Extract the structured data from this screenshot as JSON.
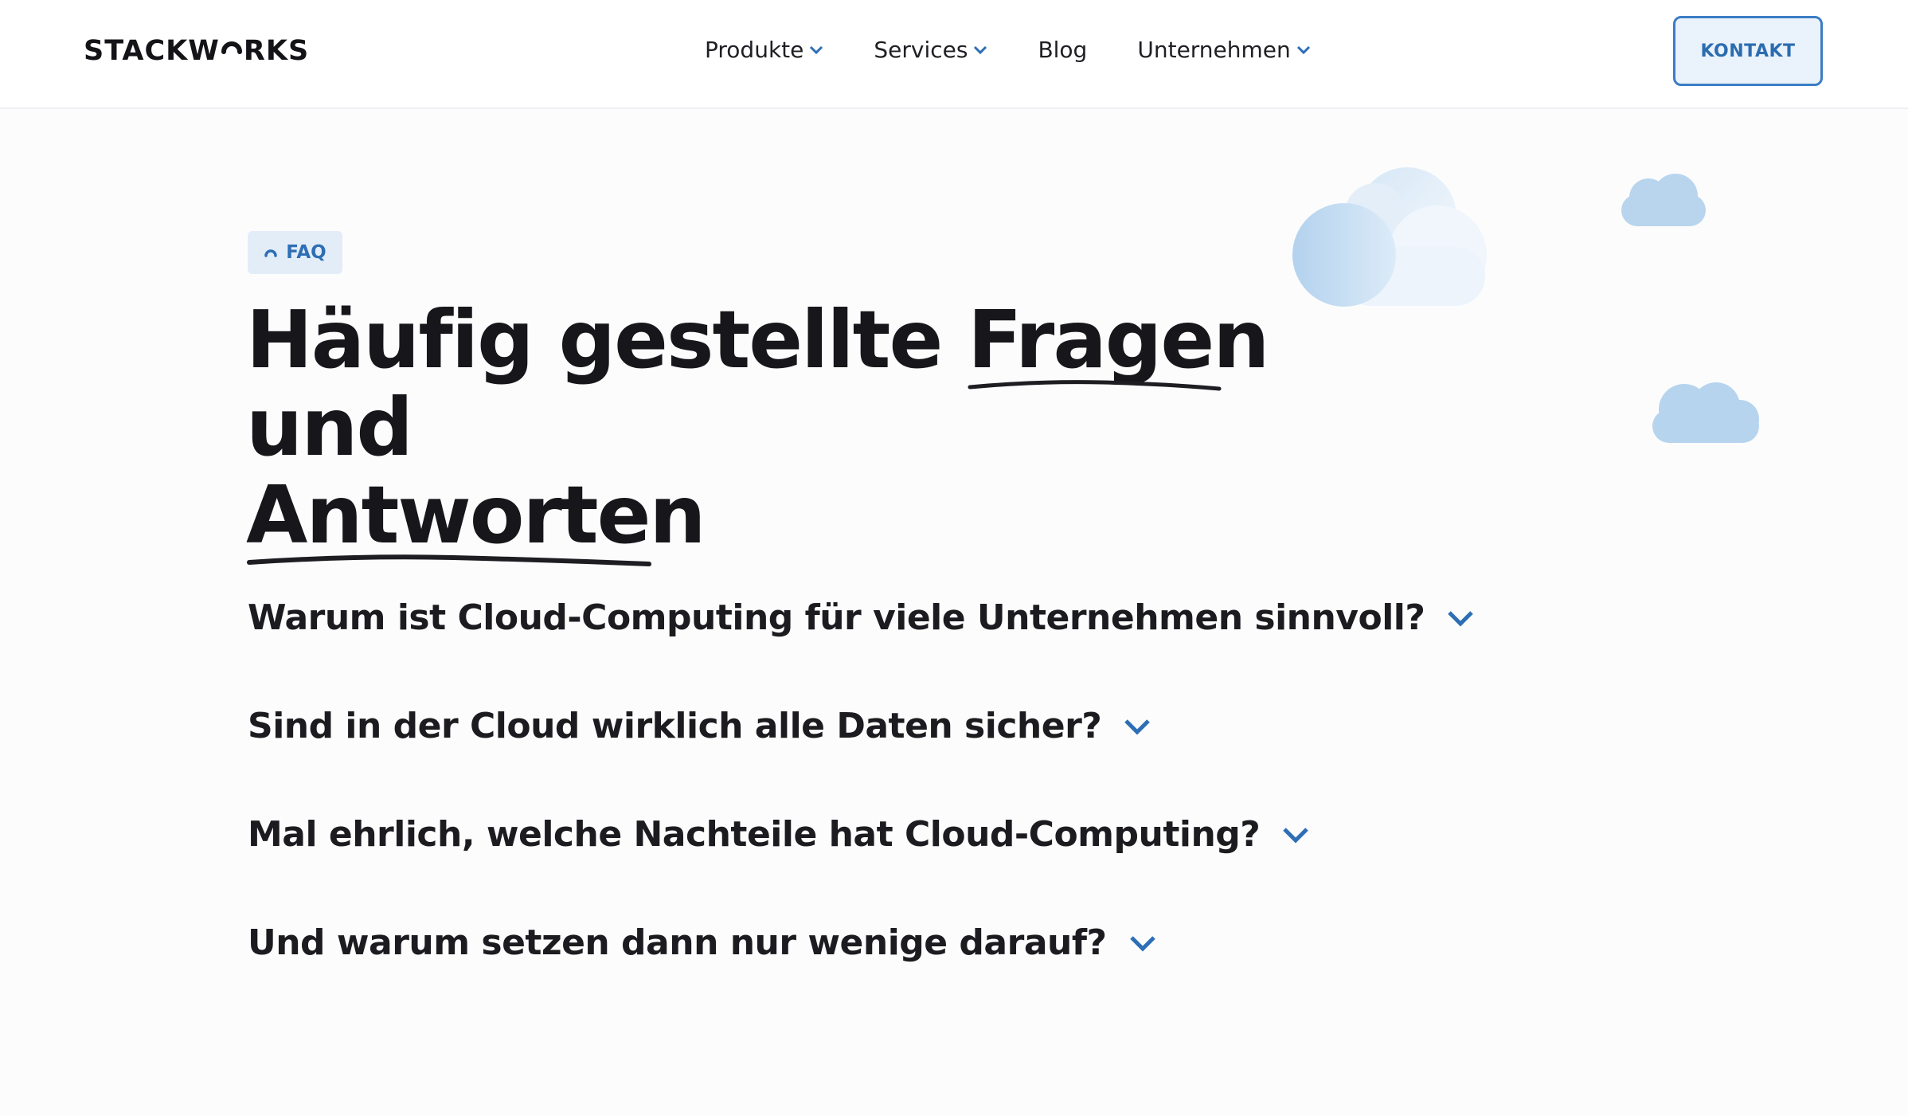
{
  "header": {
    "logo_text_left": "STACKW",
    "logo_text_right": "RKS",
    "nav": [
      {
        "label": "Produkte",
        "has_dropdown": true
      },
      {
        "label": "Services",
        "has_dropdown": true
      },
      {
        "label": "Blog",
        "has_dropdown": false
      },
      {
        "label": "Unternehmen",
        "has_dropdown": true
      }
    ],
    "contact_label": "KONTAKT"
  },
  "hero": {
    "badge_label": "FAQ",
    "headline_part1": "Häufig gestellte ",
    "headline_underlined1": "Fragen",
    "headline_part2": " und",
    "headline_underlined2": "Antworten"
  },
  "faq": {
    "items": [
      {
        "question": "Warum ist Cloud-Computing für viele Unternehmen sinnvoll?"
      },
      {
        "question": "Sind in der Cloud wirklich alle Daten sicher?"
      },
      {
        "question": "Mal ehrlich, welche Nachteile hat Cloud-Computing?"
      },
      {
        "question": "Und warum setzen dann nur wenige darauf?"
      }
    ]
  },
  "colors": {
    "accent": "#2e6eb5",
    "button_bg": "#eaf2fb",
    "text": "#1c1c20",
    "cloud": "#b7d4ee"
  }
}
